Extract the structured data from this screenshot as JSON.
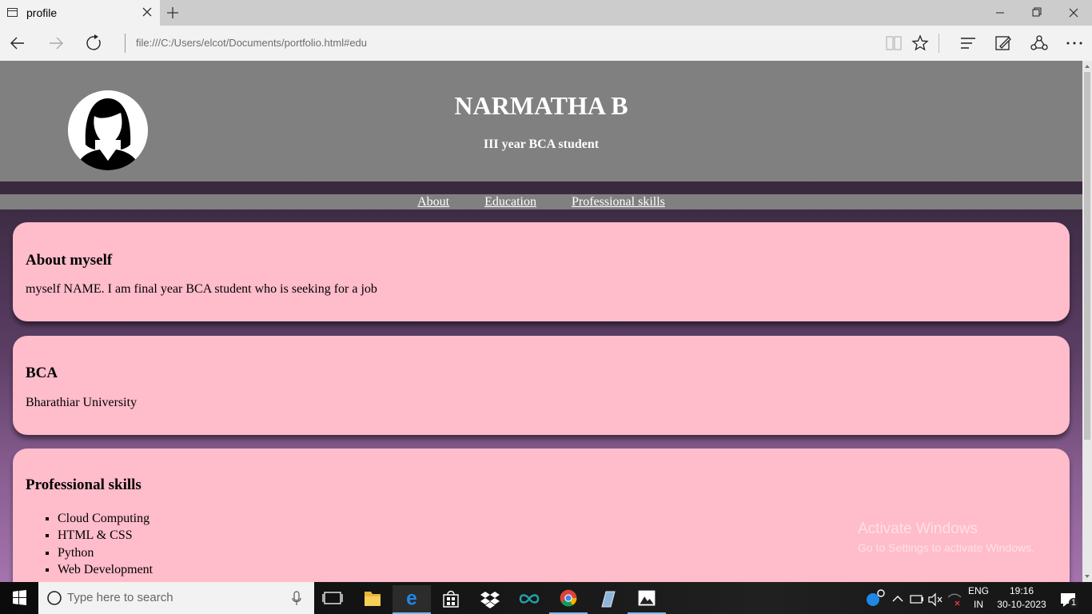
{
  "browser": {
    "tab_title": "profile",
    "address": "file:///C:/Users/elcot/Documents/portfolio.html#edu",
    "icons": [
      "page-icon",
      "close-icon",
      "plus-icon",
      "minimize-icon",
      "restore-icon",
      "window-close-icon",
      "back-icon",
      "forward-icon",
      "refresh-icon",
      "reading-view-icon",
      "favorite-star-icon",
      "hub-icon",
      "web-note-icon",
      "share-icon",
      "more-icon"
    ]
  },
  "profile": {
    "name": "NARMATHA B",
    "subtitle": "III year BCA student"
  },
  "menu": {
    "items": [
      {
        "label": "About"
      },
      {
        "label": "Education"
      },
      {
        "label": "Professional skills"
      }
    ]
  },
  "sections": {
    "about": {
      "title": "About myself",
      "text": "myself NAME. I am final year BCA student who is seeking for a job"
    },
    "education": {
      "title": "BCA",
      "text": "Bharathiar University"
    },
    "skills": {
      "title": "Professional skills",
      "items": [
        "Cloud Computing",
        "HTML & CSS",
        "Python",
        "Web Development"
      ]
    }
  },
  "watermark": {
    "title": "Activate Windows",
    "subtitle": "Go to Settings to activate Windows."
  },
  "taskbar": {
    "search_placeholder": "Type here to search",
    "language": "ENG",
    "region": "IN",
    "time": "19:16",
    "date": "30-10-2023",
    "notification_count": "1",
    "apps": [
      "task-view-icon",
      "file-explorer-icon",
      "edge-icon",
      "store-icon",
      "dropbox-icon",
      "arduino-icon",
      "chrome-icon",
      "notepad-icon",
      "photos-icon"
    ]
  },
  "colors": {
    "header_bg": "#808080",
    "card_bg": "#ffbccb",
    "page_gradient_top": "#2e1f30",
    "page_gradient_bottom": "#a474ad"
  }
}
